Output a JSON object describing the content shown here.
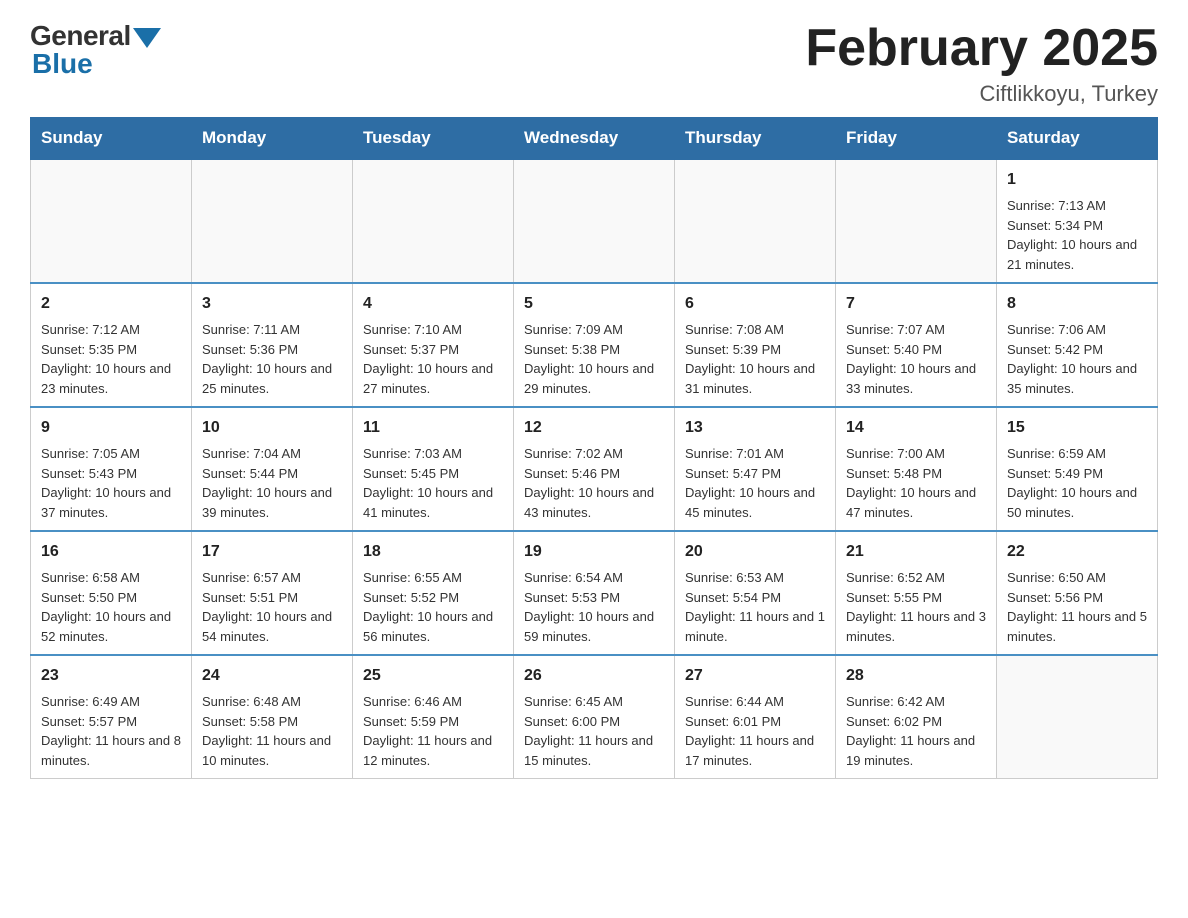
{
  "header": {
    "logo_general": "General",
    "logo_blue": "Blue",
    "month_title": "February 2025",
    "location": "Ciftlikkoyu, Turkey"
  },
  "weekdays": [
    "Sunday",
    "Monday",
    "Tuesday",
    "Wednesday",
    "Thursday",
    "Friday",
    "Saturday"
  ],
  "weeks": [
    [
      {
        "day": "",
        "info": ""
      },
      {
        "day": "",
        "info": ""
      },
      {
        "day": "",
        "info": ""
      },
      {
        "day": "",
        "info": ""
      },
      {
        "day": "",
        "info": ""
      },
      {
        "day": "",
        "info": ""
      },
      {
        "day": "1",
        "info": "Sunrise: 7:13 AM\nSunset: 5:34 PM\nDaylight: 10 hours and 21 minutes."
      }
    ],
    [
      {
        "day": "2",
        "info": "Sunrise: 7:12 AM\nSunset: 5:35 PM\nDaylight: 10 hours and 23 minutes."
      },
      {
        "day": "3",
        "info": "Sunrise: 7:11 AM\nSunset: 5:36 PM\nDaylight: 10 hours and 25 minutes."
      },
      {
        "day": "4",
        "info": "Sunrise: 7:10 AM\nSunset: 5:37 PM\nDaylight: 10 hours and 27 minutes."
      },
      {
        "day": "5",
        "info": "Sunrise: 7:09 AM\nSunset: 5:38 PM\nDaylight: 10 hours and 29 minutes."
      },
      {
        "day": "6",
        "info": "Sunrise: 7:08 AM\nSunset: 5:39 PM\nDaylight: 10 hours and 31 minutes."
      },
      {
        "day": "7",
        "info": "Sunrise: 7:07 AM\nSunset: 5:40 PM\nDaylight: 10 hours and 33 minutes."
      },
      {
        "day": "8",
        "info": "Sunrise: 7:06 AM\nSunset: 5:42 PM\nDaylight: 10 hours and 35 minutes."
      }
    ],
    [
      {
        "day": "9",
        "info": "Sunrise: 7:05 AM\nSunset: 5:43 PM\nDaylight: 10 hours and 37 minutes."
      },
      {
        "day": "10",
        "info": "Sunrise: 7:04 AM\nSunset: 5:44 PM\nDaylight: 10 hours and 39 minutes."
      },
      {
        "day": "11",
        "info": "Sunrise: 7:03 AM\nSunset: 5:45 PM\nDaylight: 10 hours and 41 minutes."
      },
      {
        "day": "12",
        "info": "Sunrise: 7:02 AM\nSunset: 5:46 PM\nDaylight: 10 hours and 43 minutes."
      },
      {
        "day": "13",
        "info": "Sunrise: 7:01 AM\nSunset: 5:47 PM\nDaylight: 10 hours and 45 minutes."
      },
      {
        "day": "14",
        "info": "Sunrise: 7:00 AM\nSunset: 5:48 PM\nDaylight: 10 hours and 47 minutes."
      },
      {
        "day": "15",
        "info": "Sunrise: 6:59 AM\nSunset: 5:49 PM\nDaylight: 10 hours and 50 minutes."
      }
    ],
    [
      {
        "day": "16",
        "info": "Sunrise: 6:58 AM\nSunset: 5:50 PM\nDaylight: 10 hours and 52 minutes."
      },
      {
        "day": "17",
        "info": "Sunrise: 6:57 AM\nSunset: 5:51 PM\nDaylight: 10 hours and 54 minutes."
      },
      {
        "day": "18",
        "info": "Sunrise: 6:55 AM\nSunset: 5:52 PM\nDaylight: 10 hours and 56 minutes."
      },
      {
        "day": "19",
        "info": "Sunrise: 6:54 AM\nSunset: 5:53 PM\nDaylight: 10 hours and 59 minutes."
      },
      {
        "day": "20",
        "info": "Sunrise: 6:53 AM\nSunset: 5:54 PM\nDaylight: 11 hours and 1 minute."
      },
      {
        "day": "21",
        "info": "Sunrise: 6:52 AM\nSunset: 5:55 PM\nDaylight: 11 hours and 3 minutes."
      },
      {
        "day": "22",
        "info": "Sunrise: 6:50 AM\nSunset: 5:56 PM\nDaylight: 11 hours and 5 minutes."
      }
    ],
    [
      {
        "day": "23",
        "info": "Sunrise: 6:49 AM\nSunset: 5:57 PM\nDaylight: 11 hours and 8 minutes."
      },
      {
        "day": "24",
        "info": "Sunrise: 6:48 AM\nSunset: 5:58 PM\nDaylight: 11 hours and 10 minutes."
      },
      {
        "day": "25",
        "info": "Sunrise: 6:46 AM\nSunset: 5:59 PM\nDaylight: 11 hours and 12 minutes."
      },
      {
        "day": "26",
        "info": "Sunrise: 6:45 AM\nSunset: 6:00 PM\nDaylight: 11 hours and 15 minutes."
      },
      {
        "day": "27",
        "info": "Sunrise: 6:44 AM\nSunset: 6:01 PM\nDaylight: 11 hours and 17 minutes."
      },
      {
        "day": "28",
        "info": "Sunrise: 6:42 AM\nSunset: 6:02 PM\nDaylight: 11 hours and 19 minutes."
      },
      {
        "day": "",
        "info": ""
      }
    ]
  ]
}
